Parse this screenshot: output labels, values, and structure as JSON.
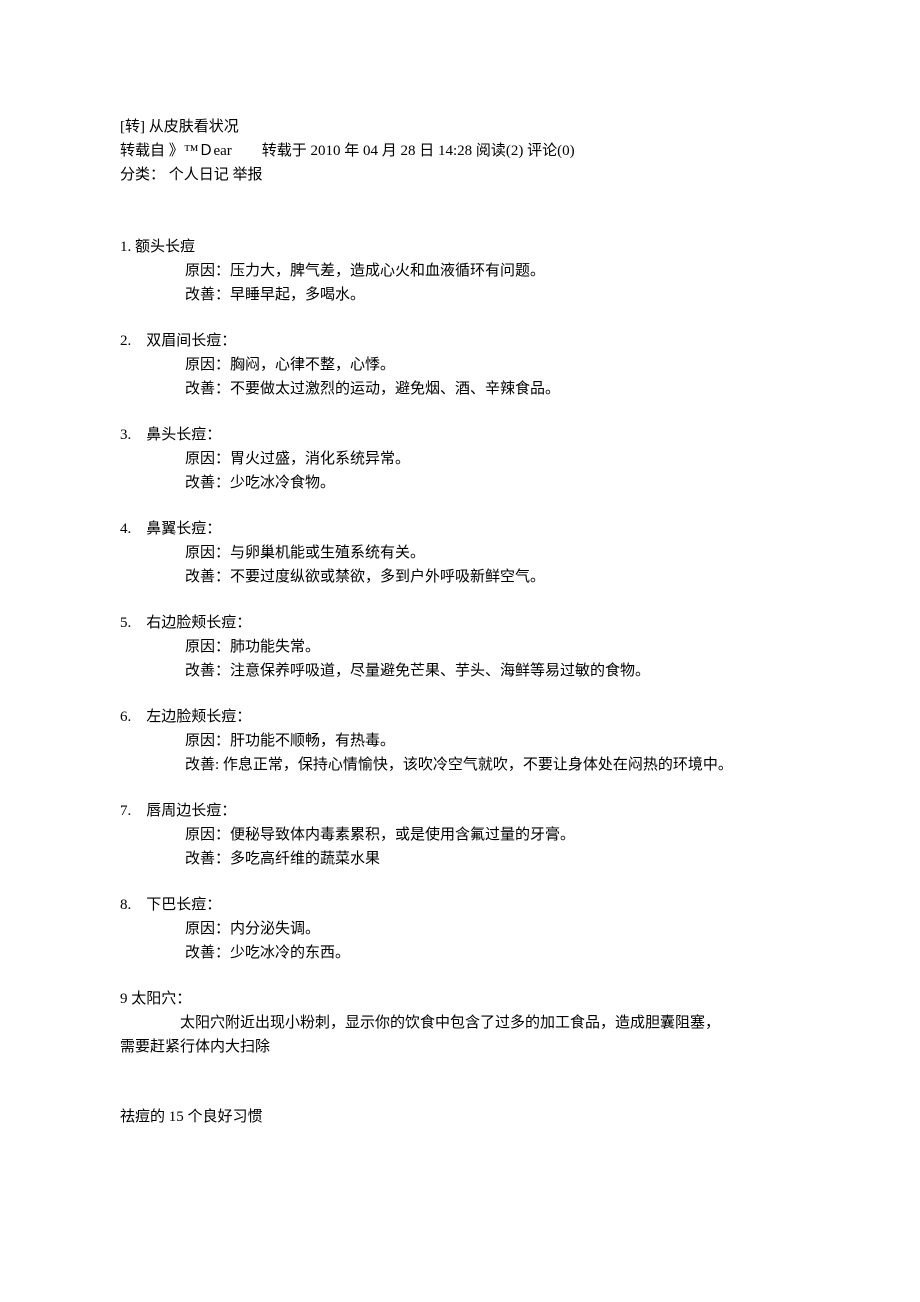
{
  "header": {
    "title": "[转] 从皮肤看状况",
    "source_line": "转载自 》™Ｄear　　转载于 2010 年 04 月 28 日 14:28 阅读(2) 评论(0)",
    "category_line": "分类： 个人日记 举报"
  },
  "items": [
    {
      "title": "1. 额头长痘",
      "reason": "原因：压力大，脾气差，造成心火和血液循环有问题。",
      "improve": "改善：早睡早起，多喝水。"
    },
    {
      "title": "2.　双眉间长痘：",
      "reason": "原因：胸闷，心律不整，心悸。",
      "improve": "改善：不要做太过激烈的运动，避免烟、酒、辛辣食品。"
    },
    {
      "title": "3.　鼻头长痘：",
      "reason": "原因：胃火过盛，消化系统异常。",
      "improve": "改善：少吃冰冷食物。"
    },
    {
      "title": "4.　鼻翼长痘：",
      "reason": "原因：与卵巢机能或生殖系统有关。",
      "improve": "改善：不要过度纵欲或禁欲，多到户外呼吸新鲜空气。"
    },
    {
      "title": "5.　右边脸颊长痘：",
      "reason": "原因：肺功能失常。",
      "improve": "改善：注意保养呼吸道，尽量避免芒果、芋头、海鲜等易过敏的食物。"
    },
    {
      "title": "6.　左边脸颊长痘：",
      "reason": "原因：肝功能不顺畅，有热毒。",
      "improve": "改善: 作息正常，保持心情愉快，该吹冷空气就吹，不要让身体处在闷热的环境中。"
    },
    {
      "title": "7.　唇周边长痘：",
      "reason": "原因：便秘导致体内毒素累积，或是使用含氟过量的牙膏。",
      "improve": "改善：多吃高纤维的蔬菜水果"
    },
    {
      "title": "8.　下巴长痘：",
      "reason": "原因：内分泌失调。",
      "improve": "改善：少吃冰冷的东西。"
    }
  ],
  "item9": {
    "title": "9 太阳穴：",
    "line1": "　　　　太阳穴附近出现小粉刺，显示你的饮食中包含了过多的加工食品，造成胆囊阻塞，",
    "line2": "需要赶紧行体内大扫除"
  },
  "footer": {
    "section": "祛痘的 15 个良好习惯"
  }
}
